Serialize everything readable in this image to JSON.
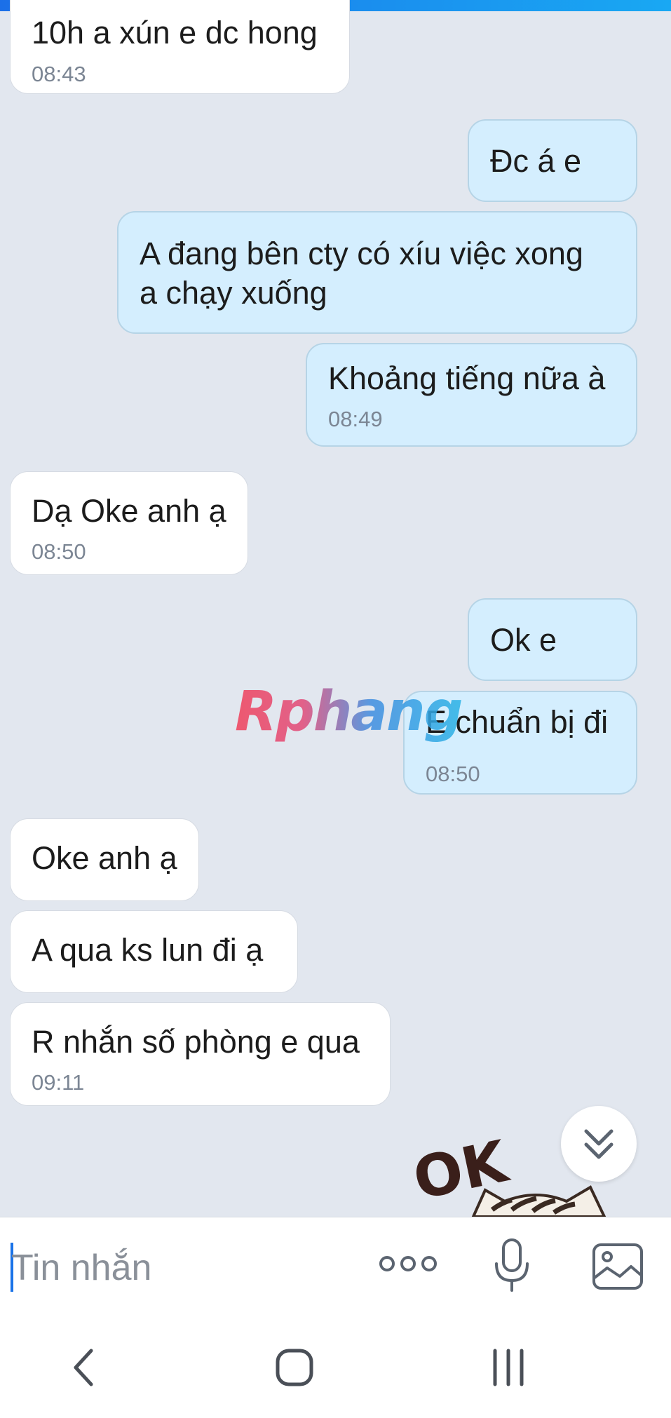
{
  "messages": [
    {
      "side": "received",
      "text": "10h a xún e dc hong",
      "time": "08:43"
    },
    {
      "side": "sent",
      "text": "Đc á e",
      "time": ""
    },
    {
      "side": "sent",
      "line1": "A đang bên cty có xíu việc xong",
      "line2": "a chạy xuống",
      "time": ""
    },
    {
      "side": "sent",
      "text": "Khoảng tiếng nữa à",
      "time": "08:49"
    },
    {
      "side": "received",
      "text": "Dạ Oke anh ạ",
      "time": "08:50"
    },
    {
      "side": "sent",
      "text": "Ok e",
      "time": ""
    },
    {
      "side": "sent",
      "text": "E chuẩn bị đi",
      "time": "08:50"
    },
    {
      "side": "received",
      "text": "Oke anh ạ",
      "time": ""
    },
    {
      "side": "received",
      "text": "A qua ks lun đi ạ",
      "time": ""
    },
    {
      "side": "received",
      "text": "R nhắn số phòng e qua",
      "time": "09:11"
    }
  ],
  "watermark": "Rphang",
  "sticker": {
    "text": "OK"
  },
  "composer": {
    "placeholder": "Tin nhắn",
    "icons": [
      "more-options-icon",
      "microphone-icon",
      "image-icon"
    ]
  },
  "scroll_button": {
    "icon": "chevrons-down-icon"
  },
  "navbar": {
    "icons": [
      "back-icon",
      "home-icon",
      "recent-apps-icon"
    ]
  },
  "colors": {
    "background": "#e2e7ef",
    "received_bubble": "#ffffff",
    "sent_bubble": "#d4eefe",
    "sent_border": "#b6d4e6",
    "accent": "#1a73e8",
    "timestamp": "#7c8694"
  }
}
